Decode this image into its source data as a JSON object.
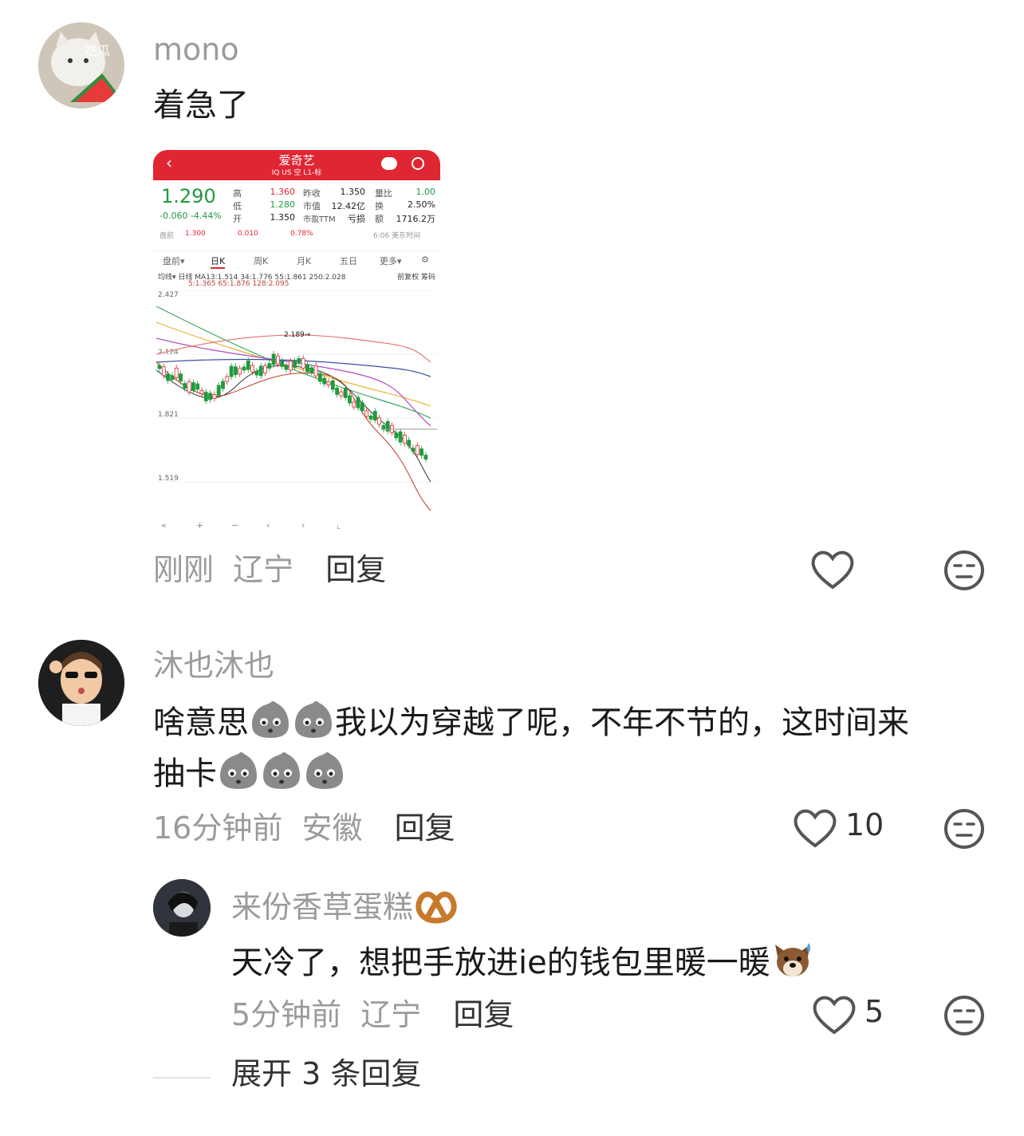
{
  "comments": [
    {
      "username": "mono",
      "avatar_badge": "吃瓜",
      "text": "着急了",
      "time": "刚刚",
      "location": "辽宁",
      "reply_label": "回复",
      "like_count": ""
    },
    {
      "username": "沐也沐也",
      "text_line1": "啥意思",
      "text_line1_rest": "我以为穿越了呢，不年不节的，这时间来",
      "text_line2": "抽卡",
      "time": "16分钟前",
      "location": "安徽",
      "reply_label": "回复",
      "like_count": "10"
    },
    {
      "username": "来份香草蛋糕",
      "text": "天冷了，想把手放进ie的钱包里暖一暖",
      "time": "5分钟前",
      "location": "辽宁",
      "reply_label": "回复",
      "like_count": "5"
    }
  ],
  "expand_replies": "展开 3 条回复",
  "stock": {
    "name": "爱奇艺",
    "sub": "IQ US 空 L1-标",
    "price": "1.290",
    "change": "-0.060  -4.44%",
    "fields": [
      {
        "label": "高",
        "value": "1.360"
      },
      {
        "label": "低",
        "value": "1.280"
      },
      {
        "label": "开",
        "value": "1.350"
      },
      {
        "label": "昨收",
        "value": "1.350"
      },
      {
        "label": "市值",
        "value": "12.42亿"
      },
      {
        "label": "市盈TTM",
        "value": "亏损"
      },
      {
        "label": "量比",
        "value": "1.00"
      },
      {
        "label": "换",
        "value": "2.50%"
      },
      {
        "label": "额",
        "value": "1716.2万"
      }
    ],
    "premarket": {
      "label": "盘前",
      "price": "1.300",
      "change": "0.010",
      "pct": "0.78%",
      "time": "6:06 美东时间"
    },
    "tabs": [
      "盘前▾",
      "日K",
      "周K",
      "月K",
      "五日",
      "更多▾"
    ],
    "ma_line1": "均线▾  日线  MA13:1.514  34:1.776  55:1.861  250:2.028",
    "ma_line2": "5:1.365  65:1.876  128:2.095",
    "ma_right": "前复权  筹码",
    "axis_labels": [
      "2.427",
      "2.124",
      "1.821",
      "1.519"
    ],
    "peak_label": "2.189→",
    "colors": {
      "red": "#e02632",
      "green": "#1f9a3d"
    }
  }
}
